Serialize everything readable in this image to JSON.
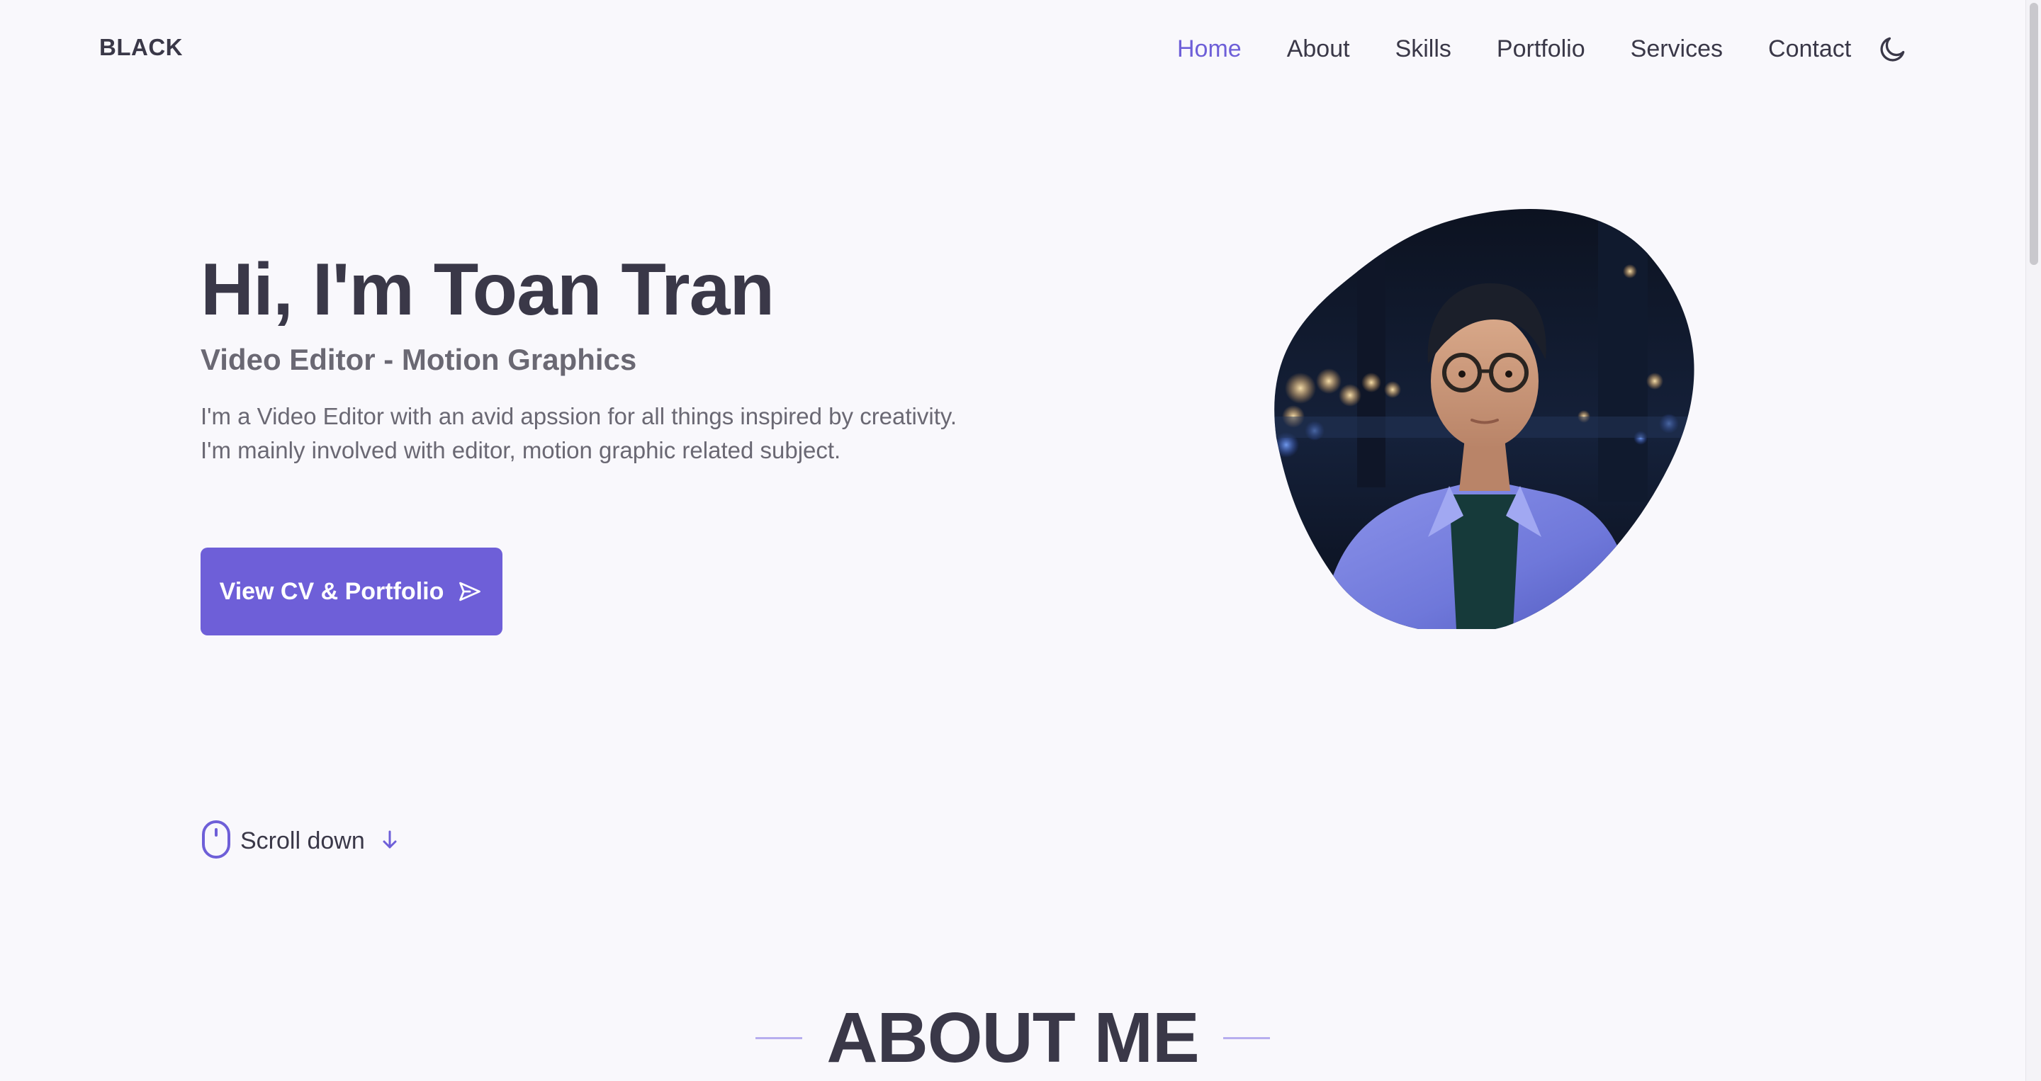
{
  "header": {
    "logo": "BLACK",
    "nav": [
      {
        "label": "Home",
        "active": true
      },
      {
        "label": "About",
        "active": false
      },
      {
        "label": "Skills",
        "active": false
      },
      {
        "label": "Portfolio",
        "active": false
      },
      {
        "label": "Services",
        "active": false
      },
      {
        "label": "Contact",
        "active": false
      }
    ],
    "theme_toggle_icon": "moon-icon"
  },
  "hero": {
    "title": "Hi, I'm Toan Tran",
    "subtitle": "Video Editor - Motion Graphics",
    "description": "I'm a Video Editor with an avid apssion for all things inspired by creativity. I'm mainly involved with editor, motion graphic related subject.",
    "cta_label": "View CV & Portfolio",
    "cta_icon": "send-icon",
    "portrait_icon": "profile-photo"
  },
  "scroll": {
    "label": "Scroll down",
    "mouse_icon": "mouse-icon",
    "arrow_icon": "arrow-down-icon"
  },
  "about": {
    "heading": "ABOUT ME"
  },
  "colors": {
    "accent": "#6e5fd8",
    "text": "#3a3848",
    "muted": "#6a6873",
    "background": "#f9f8fc"
  }
}
